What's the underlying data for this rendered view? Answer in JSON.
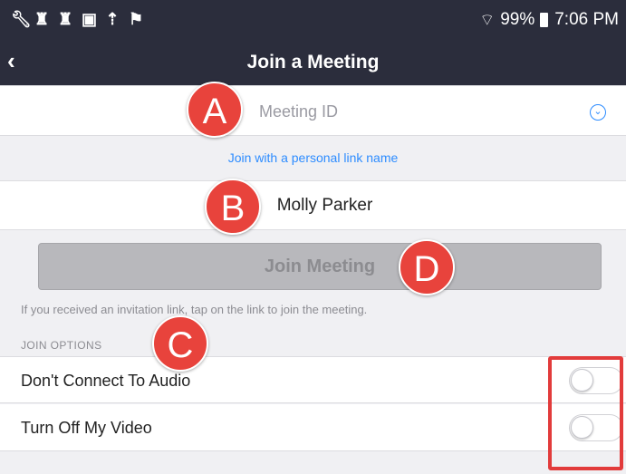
{
  "status_bar": {
    "icons": [
      "wrench-icon",
      "person-icon",
      "person-icon",
      "image-icon",
      "upload-icon",
      "flag-icon"
    ],
    "battery": "99%",
    "time": "7:06 PM"
  },
  "header": {
    "title": "Join a Meeting"
  },
  "meeting_id": {
    "placeholder": "Meeting ID"
  },
  "personal_link": "Join with a personal link name",
  "name_field": {
    "value": "Molly Parker"
  },
  "join_button": "Join Meeting",
  "hint": "If you received an invitation link, tap on the link to join the meeting.",
  "join_options": {
    "label": "JOIN OPTIONS",
    "items": [
      {
        "label": "Don't Connect To Audio",
        "enabled": false
      },
      {
        "label": "Turn Off My Video",
        "enabled": false
      }
    ]
  },
  "annotations": {
    "a": "A",
    "b": "B",
    "c": "C",
    "d": "D"
  },
  "colors": {
    "header_bg": "#2b2d3c",
    "link": "#2d8cff",
    "badge": "#e8433c",
    "highlight": "#e23b3b"
  }
}
